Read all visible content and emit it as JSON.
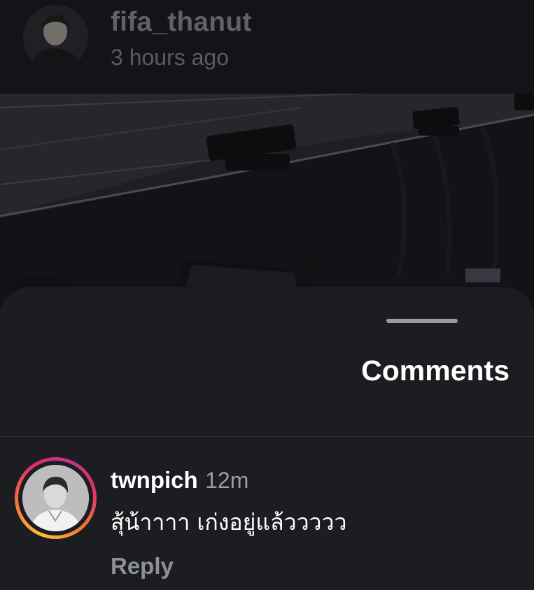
{
  "story": {
    "username": "fifa_thanut",
    "timestamp": "3 hours ago",
    "avatar": "user-avatar-photo",
    "media": "dimmed-stage-photo"
  },
  "comments_sheet": {
    "title": "Comments",
    "comments": [
      {
        "username": "twnpich",
        "time": "12m",
        "text": "สุ้น้าาาา เก่งอยู่แล้ววววว",
        "reply_label": "Reply",
        "avatar": "user-avatar-photo",
        "has_story_ring": true
      }
    ]
  },
  "colors": {
    "background": "#111214",
    "sheet": "#1c1d21",
    "muted_text": "#9a9ca2",
    "story_ring_gradient": [
      "#f9c23c",
      "#f77737",
      "#e1306c",
      "#c13584"
    ]
  }
}
